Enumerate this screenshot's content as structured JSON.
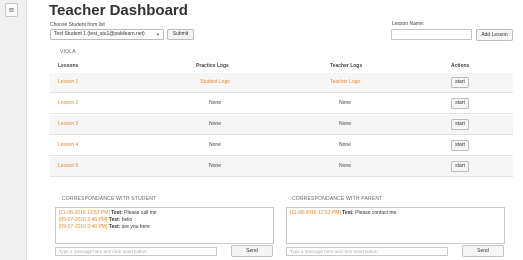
{
  "sidebar": {
    "menu_glyph": "≡",
    "menu_icon": "menu-icon"
  },
  "header": {
    "title": "Teacher Dashboard",
    "choose_label": "Choose Student from list",
    "student_selected": "Test Student 1 (test_stu1@pakilearn.net)",
    "submit_label": "Submit",
    "lesson_name_label": "Lesson Name:",
    "lesson_name_value": "",
    "add_lesson_label": "Add Lesson"
  },
  "section_title": "VIOLA",
  "table": {
    "columns": [
      "Lessons",
      "Practice Logs",
      "Teacher Logs",
      "Actions"
    ],
    "rows": [
      {
        "lesson": "Lesson 1",
        "practice": "Student Logs",
        "teacher": "Teacher Logs",
        "action": "start"
      },
      {
        "lesson": "Lesson 2",
        "practice": "None",
        "teacher": "None",
        "action": "start"
      },
      {
        "lesson": "Lesson 3",
        "practice": "None",
        "teacher": "None",
        "action": "start"
      },
      {
        "lesson": "Lesson 4",
        "practice": "None",
        "teacher": "None",
        "action": "start"
      },
      {
        "lesson": "Lesson 5",
        "practice": "None",
        "teacher": "None",
        "action": "start"
      }
    ]
  },
  "correspondence": {
    "student": {
      "title": "CORRESPONDANCE WITH STUDENT",
      "messages": [
        {
          "time": "[11-08-2016 12:52 PM]",
          "from": "Test:",
          "text": "Please call me"
        },
        {
          "time": "[09-07-2016 2:46 PM]",
          "from": "Test:",
          "text": "hello"
        },
        {
          "time": "[09-07-2016 2:46 PM]",
          "from": "Test:",
          "text": "are you here"
        }
      ],
      "input_placeholder": "Type a message here and click Send button.",
      "send_label": "Send"
    },
    "parent": {
      "title": "CORRESPONDANCE WITH PARENT",
      "messages": [
        {
          "time": "[11-08-2016 12:52 PM]",
          "from": "Test:",
          "text": "Please contact me"
        }
      ],
      "input_placeholder": "Type a message here and click Send button.",
      "send_label": "Send"
    }
  },
  "colors": {
    "link": "#e58a2e",
    "row_alt": "#f6f6f6",
    "text": "#333333"
  }
}
